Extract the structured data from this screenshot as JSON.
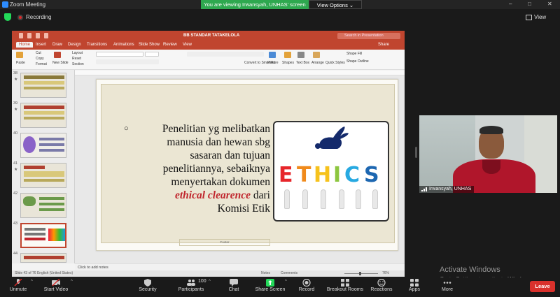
{
  "window": {
    "title": "Zoom Meeting",
    "banner": "You are viewing Irwansyah, UNHAS' screen",
    "view_options": "View Options ⌄",
    "recording_label": "Recording",
    "view_label": "View"
  },
  "ppt": {
    "doc_title": "BB STANDAR TATAKELOLA",
    "search_placeholder": "Search in Presentation",
    "share_label": "Share",
    "tabs": [
      "Home",
      "Insert",
      "Draw",
      "Design",
      "Transitions",
      "Animations",
      "Slide Show",
      "Review",
      "View"
    ],
    "ribbon": {
      "paste": "Paste",
      "cut": "Cut",
      "copy": "Copy",
      "format": "Format",
      "new_slide": "New Slide",
      "layout": "Layout",
      "reset": "Reset",
      "section": "Section",
      "convert": "Convert to SmartArt",
      "picture": "Picture",
      "shapes": "Shapes",
      "text_box": "Text Box",
      "arrange": "Arrange",
      "quick_styles": "Quick Styles",
      "shape_fill": "Shape Fill",
      "shape_outline": "Shape Outline"
    },
    "thumbs": [
      {
        "num": "38",
        "star": "★"
      },
      {
        "num": "39",
        "star": "★"
      },
      {
        "num": "40",
        "star": ""
      },
      {
        "num": "41",
        "star": "★"
      },
      {
        "num": "42",
        "star": ""
      },
      {
        "num": "43",
        "star": ""
      },
      {
        "num": "44",
        "star": ""
      }
    ],
    "slide": {
      "line1": "Penelitian yg melibatkan",
      "line2": "manusia dan hewan sbg",
      "line3": "sasaran  dan tujuan",
      "line4": "penelitiannya, sebaiknya",
      "line5": "menyertakan dokumen",
      "line6_em": "ethical clearence",
      "line6_rest": " dari",
      "line7": "Komisi Etik",
      "footer": "Footer",
      "ethics_letters": [
        "E",
        "T",
        "H",
        "I",
        "C",
        "S"
      ]
    },
    "notes": "Click to add notes",
    "status_left": "Slide 43 of 76     English (United States)",
    "status_notes": "Notes",
    "status_comments": "Comments",
    "zoom_pct": "76%"
  },
  "participant": {
    "name": "Irwansyah, UNHAS"
  },
  "watermark": {
    "line1": "Activate Windows",
    "line2": "Go to Settings to activate Windows."
  },
  "toolbar": {
    "unmute": "Unmute",
    "start_video": "Start Video",
    "security": "Security",
    "participants": "Participants",
    "participants_count": "100",
    "chat": "Chat",
    "share_screen": "Share Screen",
    "record": "Record",
    "breakout": "Breakout Rooms",
    "reactions": "Reactions",
    "apps": "Apps",
    "more": "More",
    "leave": "Leave"
  },
  "colors": {
    "ppt_accent": "#c0452f",
    "leave_red": "#d9312c",
    "banner_green": "#2ea84f",
    "share_green": "#23d959"
  }
}
